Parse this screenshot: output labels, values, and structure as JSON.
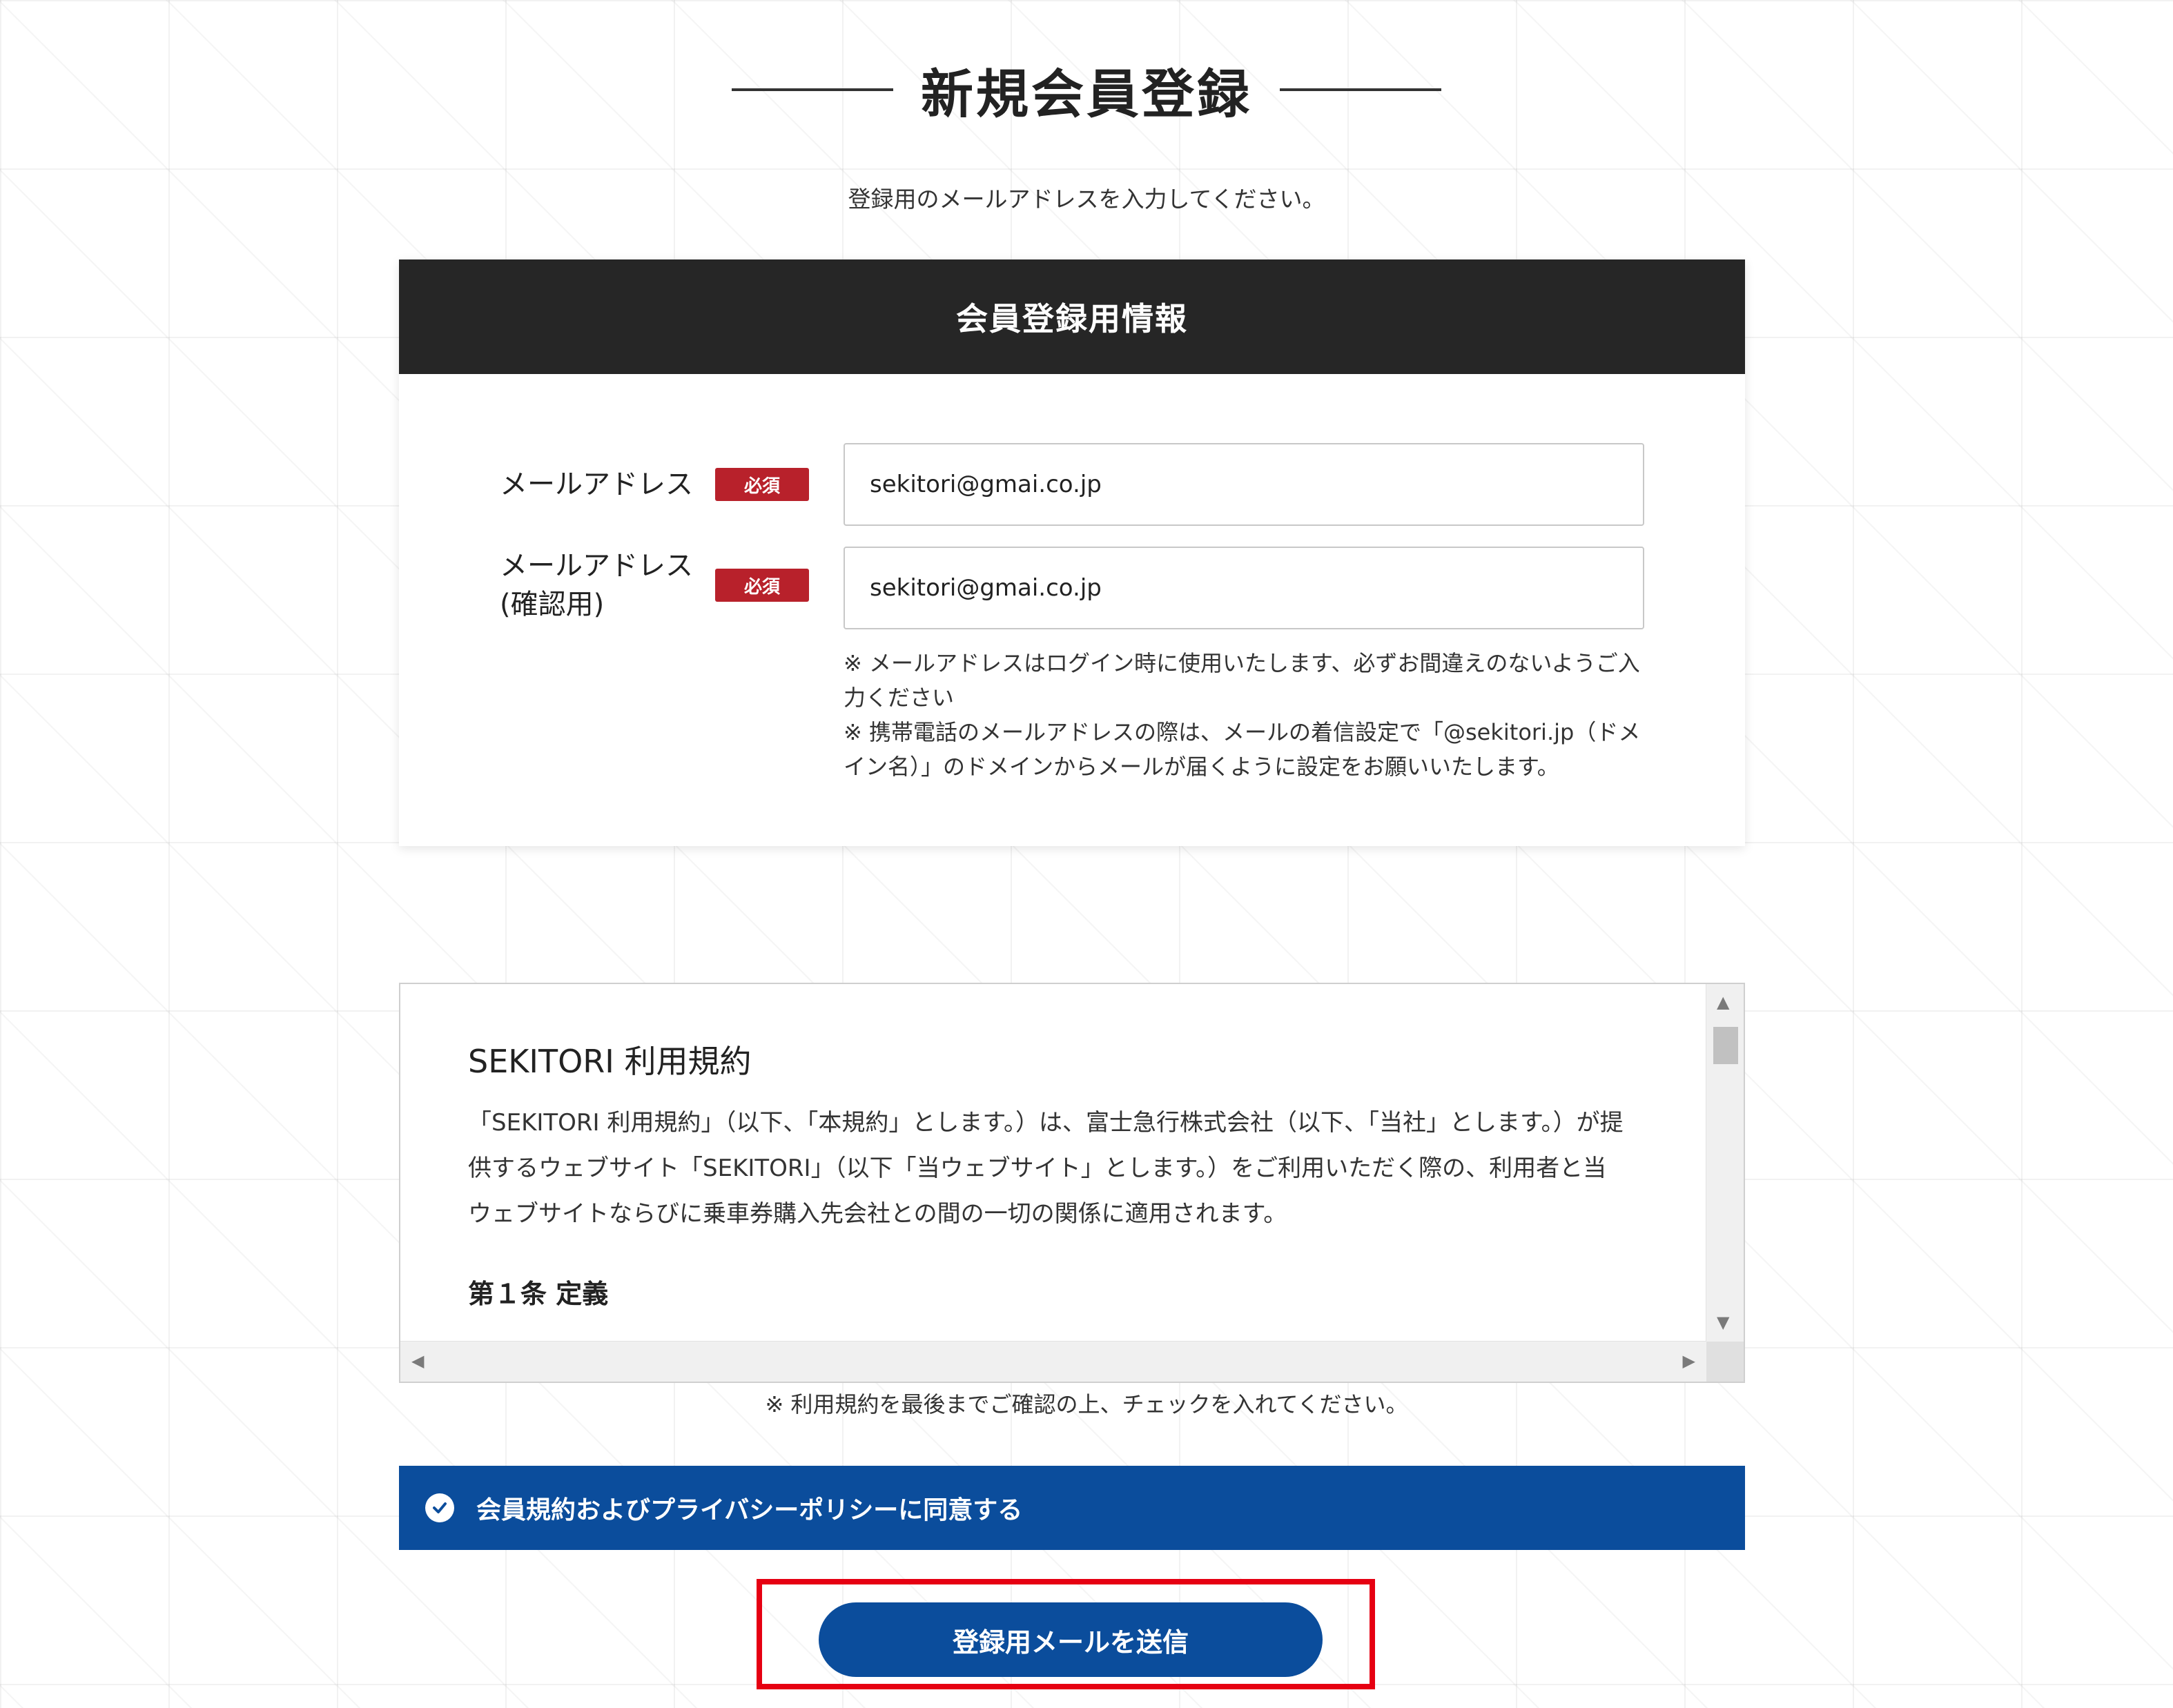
{
  "page": {
    "title": "新規会員登録",
    "intro": "登録用のメールアドレスを入力してください。"
  },
  "card": {
    "header": "会員登録用情報",
    "required_badge": "必須",
    "email_label": "メールアドレス",
    "email_value": "sekitori@gmai.co.jp",
    "confirm_label_line1": "メールアドレス",
    "confirm_label_line2": "(確認用)",
    "confirm_value": "sekitori@gmai.co.jp",
    "notes": [
      "※ メールアドレスはログイン時に使用いたします、必ずお間違えのないようご入力ください",
      "※ 携帯電話のメールアドレスの際は、メールの着信設定で「@sekitori.jp（ドメイン名）」のドメインからメールが届くように設定をお願いいたします。"
    ]
  },
  "terms": {
    "title": "SEKITORI 利用規約",
    "body": "「SEKITORI 利用規約」（以下、「本規約」とします。）は、富士急行株式会社（以下、「当社」とします。）が提供するウェブサイト「SEKITORI」（以下「当ウェブサイト」とします。）をご利用いただく際の、利用者と当ウェブサイトならびに乗車券購入先会社との間の一切の関係に適用されます。",
    "article1": "第１条 定義",
    "note": "※ 利用規約を最後までご確認の上、チェックを入れてください。"
  },
  "agree": {
    "label": "会員規約およびプライバシーポリシーに同意する",
    "checked": true
  },
  "submit": {
    "label": "登録用メールを送信"
  },
  "colors": {
    "header_bg": "#262626",
    "required_badge": "#b8212b",
    "brand_blue": "#0b4d9c",
    "highlight": "#e60012"
  }
}
